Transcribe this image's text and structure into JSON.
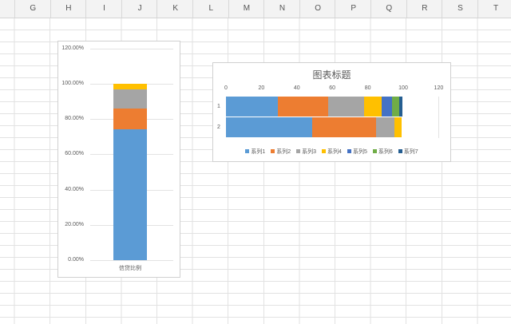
{
  "columns": [
    "G",
    "H",
    "I",
    "J",
    "K",
    "L",
    "M",
    "N",
    "O",
    "P",
    "Q",
    "R",
    "S",
    "T"
  ],
  "colors": {
    "s1": "#5b9bd5",
    "s2": "#ed7d31",
    "s3": "#a5a5a5",
    "s4": "#ffc000",
    "s5": "#4472c4",
    "s6": "#70ad47",
    "s7": "#255e91"
  },
  "chart_data": [
    {
      "type": "bar",
      "stacked": true,
      "orientation": "vertical",
      "categories": [
        "信贷比例"
      ],
      "series": [
        {
          "name": "s1",
          "values": [
            74.2
          ]
        },
        {
          "name": "s2",
          "values": [
            11.8
          ]
        },
        {
          "name": "s3",
          "values": [
            10.8
          ]
        },
        {
          "name": "s4",
          "values": [
            3.2
          ]
        }
      ],
      "ylim": [
        0,
        120
      ],
      "yticks": [
        "0.00%",
        "20.00%",
        "40.00%",
        "60.00%",
        "80.00%",
        "100.00%",
        "120.00%"
      ],
      "grid": true
    },
    {
      "type": "bar",
      "stacked": true,
      "orientation": "horizontal",
      "title": "图表标题",
      "categories": [
        "1",
        "2"
      ],
      "series": [
        {
          "name": "系列1",
          "values": [
            29.3,
            48.7
          ]
        },
        {
          "name": "系列2",
          "values": [
            28.2,
            36.2
          ]
        },
        {
          "name": "系列3",
          "values": [
            20.5,
            10.2
          ]
        },
        {
          "name": "系列4",
          "values": [
            9.9,
            4.2
          ]
        },
        {
          "name": "系列5",
          "values": [
            6.0,
            0
          ]
        },
        {
          "name": "系列6",
          "values": [
            3.7,
            0
          ]
        },
        {
          "name": "系列7",
          "values": [
            2.1,
            0
          ]
        }
      ],
      "xlim": [
        0,
        120
      ],
      "xticks": [
        "0",
        "20",
        "40",
        "60",
        "80",
        "100",
        "120"
      ],
      "legend": "bottom"
    }
  ]
}
